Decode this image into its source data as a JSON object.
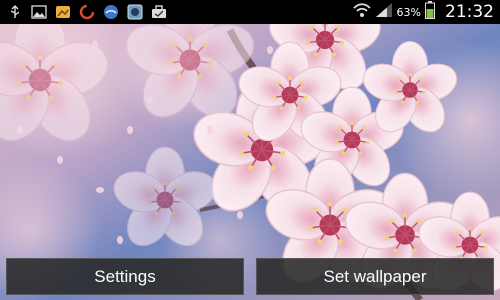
{
  "status_bar": {
    "battery_percent": "63%",
    "time": "21:32",
    "notification_icons": [
      "usb-icon",
      "image-icon",
      "gallery-icon",
      "sync-icon",
      "browser-icon",
      "app-icon",
      "briefcase-icon"
    ],
    "system_icons": [
      "wifi-icon",
      "signal-icon",
      "battery-icon"
    ]
  },
  "wallpaper": {
    "subject": "cherry blossoms",
    "colors": {
      "petal": "#f4dde6",
      "petal_shadow": "#e7b9cb",
      "center": "#b43a55",
      "sky": "#6f86c0",
      "branch": "#5a3a3a"
    }
  },
  "actions": {
    "settings_label": "Settings",
    "set_wallpaper_label": "Set wallpaper"
  }
}
